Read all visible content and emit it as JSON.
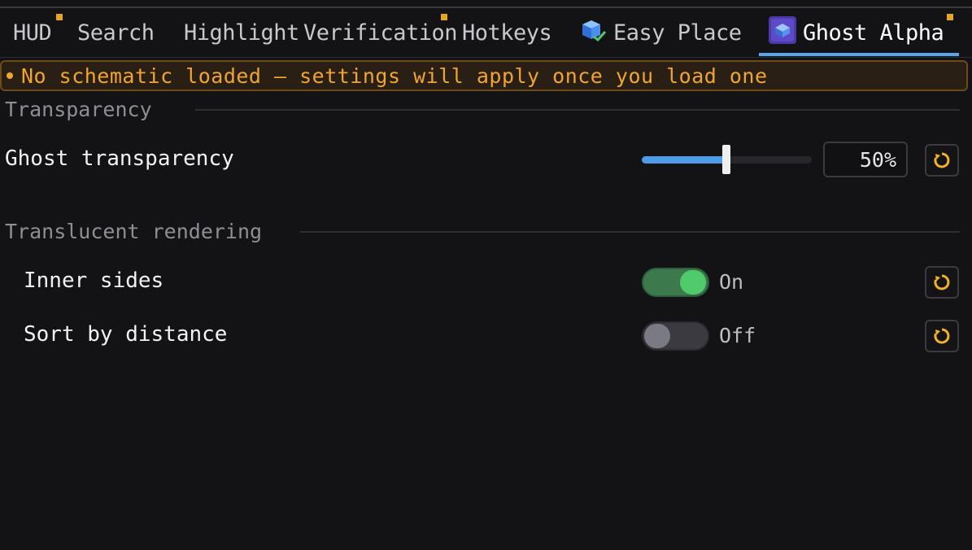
{
  "tabs": [
    {
      "label": "HUD",
      "modified": true
    },
    {
      "label": "Search",
      "modified": false
    },
    {
      "label": "Highlight",
      "modified": false
    },
    {
      "label": "Verification",
      "modified": true
    },
    {
      "label": "Hotkeys",
      "modified": false
    },
    {
      "label": "Easy Place",
      "icon": "blue-cube-check-icon",
      "modified": false
    },
    {
      "label": "Ghost Alpha",
      "icon": "ghost-block-icon",
      "modified": true,
      "active": true
    }
  ],
  "banner": {
    "text": "No schematic loaded — settings will apply once you load one"
  },
  "sections": {
    "transparency": {
      "title": "Transparency",
      "ghost_transparency": {
        "label": "Ghost transparency",
        "value": 50,
        "display": "50%"
      }
    },
    "translucent": {
      "title": "Translucent rendering",
      "inner_sides": {
        "label": "Inner sides",
        "on": true,
        "state_label": "On"
      },
      "sort_by_distance": {
        "label": "Sort by distance",
        "on": false,
        "state_label": "Off"
      }
    }
  },
  "colors": {
    "accent": "#5aa6ec",
    "modified_dot": "#e6a51e",
    "warning": "#f0a530",
    "toggle_on": "#4fcb6b"
  }
}
